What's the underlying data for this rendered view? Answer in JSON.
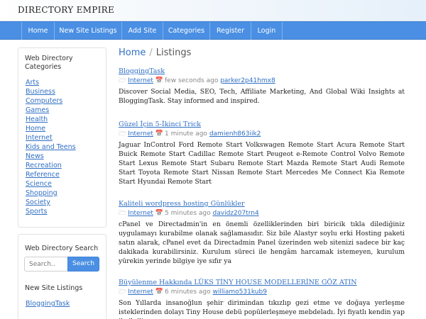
{
  "site": {
    "brand": "DIRECTORY EMPIRE"
  },
  "nav": {
    "items": [
      {
        "label": "Home"
      },
      {
        "label": "New Site Listings"
      },
      {
        "label": "Add Site"
      },
      {
        "label": "Categories"
      },
      {
        "label": "Register"
      },
      {
        "label": "Login"
      }
    ]
  },
  "sidebar": {
    "categories_title": "Web Directory Categories",
    "categories": [
      "Arts",
      "Business",
      "Computers",
      "Games",
      "Health",
      "Home",
      "Internet",
      "Kids and Teens",
      "News",
      "Recreation",
      "Reference",
      "Science",
      "Shopping",
      "Society",
      "Sports"
    ],
    "search_title": "Web Directory Search",
    "search_placeholder": "Search..",
    "search_button": "Search",
    "new_listings_title": "New Site Listings",
    "new_listings": [
      "BloggingTask"
    ]
  },
  "breadcrumb": {
    "home": "Home",
    "separator": "/",
    "current": "Listings"
  },
  "listings": [
    {
      "title": "BloggingTask",
      "category": "Internet",
      "time": "few seconds ago",
      "user": "parker2p41hmx8",
      "description": "Discover Social Media, SEO, Tech, Affiliate Marketing, And Global Wiki Insights at BloggingTask. Stay informed and inspired."
    },
    {
      "title": "Güzel İçin 5-İkinci Trick",
      "category": "Internet",
      "time": "1 minute ago",
      "user": "damienh863iik2",
      "description": "Jaguar InControl Ford Remote Start Volkswagen Remote Start Acura Remote Start Buick Remote Start Cadillac Remote Start Peugeot e-Remote Control Volvo Remote Start Lexus Remote Start Subaru Remote Start Mazda Remote Start Audi Remote Start Toyota Remote Start Nissan Remote Start Mercedes Me Connect Kia Remote Start Hyundai Remote Start"
    },
    {
      "title": "Kaliteli wordpress hosting Günlükler",
      "category": "Internet",
      "time": "5 minutes ago",
      "user": "davidz207trn4",
      "description": "cPanel ve Directadmin'in en önemli özelliklerinden biri biricik tıkla dilediğiniz uygulamayı kurabilme olanak sağlamasıdır. Siz bile Alastyr soylu erki Hosting paketi satın alarak, cPanel evet da Directadmin Panel üzerinden web sitenizi sadece bir kaç dakikada kurabilirsiniz. Kurulum süreci ile hengâm harcamak istemeyen, kurulum yürekin yerinde bilgiye iye sıfır ya"
    },
    {
      "title": "Büyülenme Hakkında LÜKS TİNY HOUSE MODELLERİNE GÖZ ATIN",
      "category": "Internet",
      "time": "6 minutes ago",
      "user": "williamo531kub9",
      "description": "Son Yıllarda insanoğlun şehir dirimindan tıkızlıp gezi etme ve doğaya yerleşme isteklerinden dolayı Tiny House debü popülerleşmeye mebdeladı. İyi fiyatlı kendin yap ile ilgili"
    }
  ],
  "colors": {
    "accent": "#4a8fe3",
    "link": "#2f6fc4"
  }
}
